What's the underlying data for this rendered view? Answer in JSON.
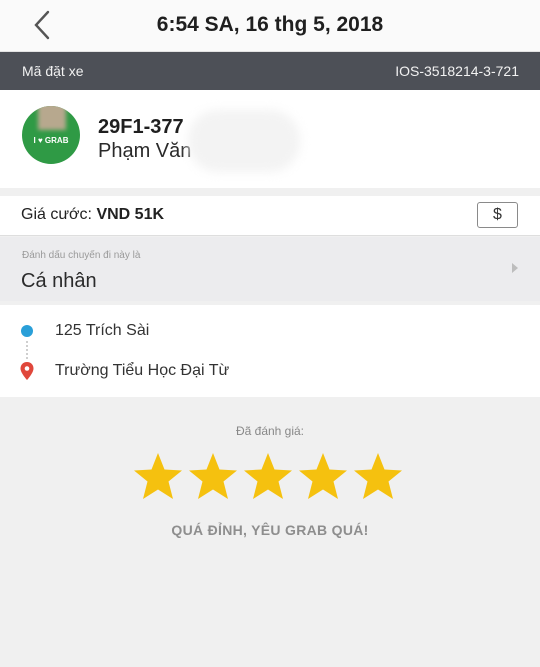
{
  "header": {
    "title": "6:54 SA, 16 thg 5, 2018",
    "back_icon": "chevron-left-icon"
  },
  "booking": {
    "label": "Mã đặt xe",
    "id": "IOS-3518214-3-721"
  },
  "driver": {
    "plate": "29F1-377",
    "name": "Phạm Văn",
    "shirt_text": "I ♥ GRAB"
  },
  "fare": {
    "label": "Giá cước:",
    "amount": "VND 51K",
    "currency_button": "$"
  },
  "trip_type": {
    "hint": "Đánh dấu chuyến đi này là",
    "value": "Cá nhân"
  },
  "route": {
    "pickup": "125 Trích Sài",
    "dropoff": "Trường Tiểu Học Đại Từ"
  },
  "rating": {
    "label": "Đã đánh giá:",
    "stars": 5,
    "max_stars": 5,
    "comment": "QUÁ ĐỈNH, YÊU GRAB QUÁ!"
  },
  "colors": {
    "booking_bar": "#4d5057",
    "pickup_dot": "#2a9fd8",
    "dropoff_pin": "#e0473b",
    "star": "#f5c10f",
    "avatar": "#2f9a45"
  }
}
